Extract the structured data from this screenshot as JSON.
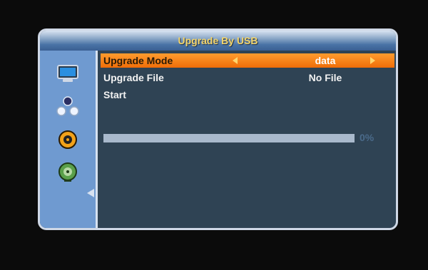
{
  "title": "Upgrade By USB",
  "sidebar": {
    "items": [
      {
        "icon": "monitor-icon"
      },
      {
        "icon": "network-icon"
      },
      {
        "icon": "gear-icon"
      },
      {
        "icon": "satellite-dish-icon",
        "selected": true
      }
    ]
  },
  "rows": [
    {
      "label": "Upgrade Mode",
      "value": "data"
    },
    {
      "label": "Upgrade File",
      "value": "No File"
    },
    {
      "label": "Start"
    }
  ],
  "progress": {
    "percent": 100,
    "label": "0%"
  },
  "colors": {
    "accent": "#f07a12",
    "title": "#f4d56a",
    "panel": "#2f4354",
    "sidebar": "#6f9ad0"
  }
}
